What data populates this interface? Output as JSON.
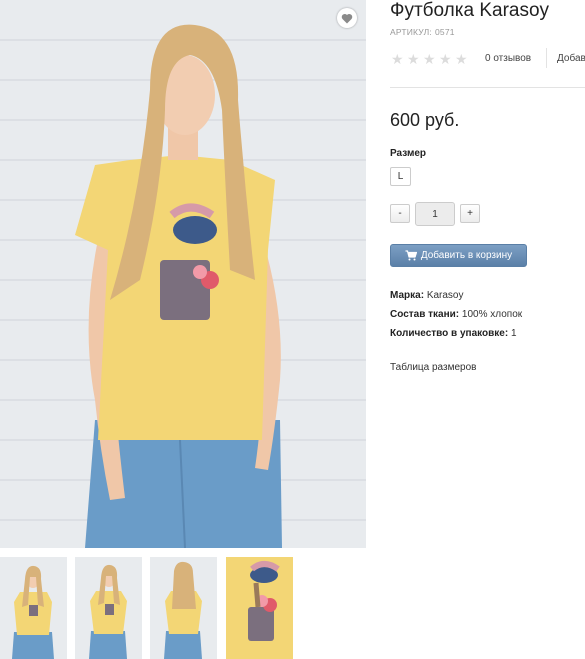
{
  "product": {
    "title": "Футболка Karasoy",
    "sku_label": "АРТИКУЛ:",
    "sku_value": "0571",
    "rating": {
      "value": 0,
      "max": 5
    },
    "reviews_label": "0 отзывов",
    "add_review_label": "Добав",
    "price": "600 руб."
  },
  "options": {
    "size_label": "Размер",
    "sizes": [
      "L"
    ]
  },
  "quantity": {
    "minus": "-",
    "value": "1",
    "plus": "+"
  },
  "cart": {
    "button_label": "Добавить в корзину",
    "icon": "cart-icon"
  },
  "specs": [
    {
      "label": "Марка:",
      "value": "Karasoy"
    },
    {
      "label": "Состав ткани:",
      "value": "100% хлопок"
    },
    {
      "label": "Количество в упаковке:",
      "value": "1"
    }
  ],
  "size_table_link": "Таблица размеров",
  "gallery": {
    "wishlist_icon": "heart-icon",
    "thumbnails": [
      "front",
      "front-pose",
      "back",
      "print-detail"
    ]
  },
  "colors": {
    "shirt": "#f3d675",
    "jeans": "#6a9cc8",
    "wall": "#e9ecef",
    "cart_button": "#6b8fb8",
    "star_empty": "#dcdcdc"
  }
}
